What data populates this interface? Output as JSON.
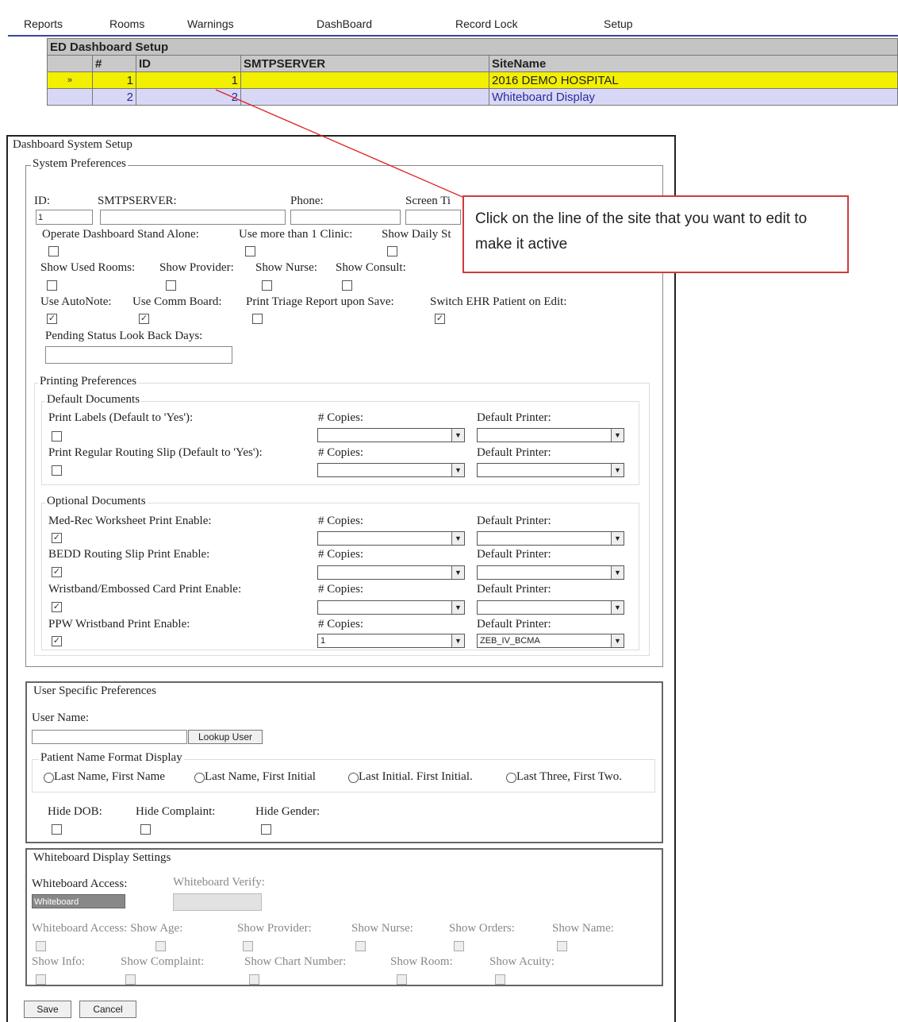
{
  "menu": [
    "Reports",
    "Rooms",
    "Warnings",
    "DashBoard",
    "Record Lock",
    "Setup"
  ],
  "grid": {
    "title": "ED Dashboard Setup",
    "headers": [
      "#",
      "ID",
      "SMTPSERVER",
      "SiteName"
    ],
    "rows": [
      {
        "marker": "»",
        "num": "1",
        "id": "1",
        "smtp": "",
        "site": "2016 DEMO HOSPITAL"
      },
      {
        "marker": "",
        "num": "2",
        "id": "2",
        "smtp": "",
        "site": "Whiteboard Display"
      }
    ]
  },
  "callout": {
    "text": "Click on the line of the site that you want to edit to make it active",
    "border_color": "#d23a3a"
  },
  "panel": {
    "title": "Dashboard System Setup",
    "system_preferences": {
      "legend": "System Preferences",
      "id_label": "ID:",
      "id_value": "1",
      "smtp_label": "SMTPSERVER:",
      "phone_label": "Phone:",
      "screen_label": "Screen Ti",
      "row1": [
        {
          "label": "Operate Dashboard Stand Alone:",
          "checked": false
        },
        {
          "label": "Use more than 1 Clinic:",
          "checked": false
        },
        {
          "label": "Show Daily St",
          "checked": false
        }
      ],
      "row2": [
        {
          "label": "Show Used Rooms:",
          "checked": false
        },
        {
          "label": "Show Provider:",
          "checked": false
        },
        {
          "label": "Show Nurse:",
          "checked": false
        },
        {
          "label": "Show Consult:",
          "checked": false
        }
      ],
      "row3": [
        {
          "label": "Use AutoNote:",
          "checked": true
        },
        {
          "label": "Use Comm Board:",
          "checked": true
        },
        {
          "label": "Print Triage Report upon Save:",
          "checked": false
        },
        {
          "label": "Switch EHR Patient on Edit:",
          "checked": true
        }
      ],
      "pending_label": "Pending Status Look Back Days:"
    },
    "printing": {
      "legend": "Printing Preferences",
      "default_docs_legend": "Default Documents",
      "copies_label": "# Copies:",
      "printer_label": "Default Printer:",
      "default_docs": [
        {
          "label": "Print Labels (Default to 'Yes'):",
          "checked": false,
          "copies": "",
          "printer": ""
        },
        {
          "label": "Print Regular Routing Slip (Default to 'Yes'):",
          "checked": false,
          "copies": "",
          "printer": ""
        }
      ],
      "optional_docs_legend": "Optional Documents",
      "optional_docs": [
        {
          "label": "Med-Rec Worksheet Print Enable:",
          "checked": true,
          "copies": "",
          "printer": ""
        },
        {
          "label": "BEDD Routing Slip Print Enable:",
          "checked": true,
          "copies": "",
          "printer": ""
        },
        {
          "label": "Wristband/Embossed Card Print Enable:",
          "checked": true,
          "copies": "",
          "printer": ""
        },
        {
          "label": "PPW Wristband Print Enable:",
          "checked": true,
          "copies": "1",
          "printer": "ZEB_IV_BCMA"
        }
      ]
    },
    "user_prefs": {
      "legend": "User Specific Preferences",
      "user_name_label": "User Name:",
      "lookup_button": "Lookup User",
      "name_format_legend": "Patient Name Format Display",
      "name_formats": [
        "Last Name, First Name",
        "Last Name, First Initial",
        "Last Initial. First Initial.",
        "Last Three, First Two."
      ],
      "hide": [
        {
          "label": "Hide DOB:",
          "checked": false
        },
        {
          "label": "Hide Complaint:",
          "checked": false
        },
        {
          "label": "Hide Gender:",
          "checked": false
        }
      ]
    },
    "whiteboard": {
      "legend": "Whiteboard Display Settings",
      "access_label": "Whiteboard Access:",
      "access_value": "Whiteboard",
      "verify_label": "Whiteboard Verify:",
      "row1": [
        "Whiteboard Access: Show Age:",
        "Show Provider:",
        "Show Nurse:",
        "Show Orders:",
        "Show Name:"
      ],
      "row2": [
        "Show Info:",
        "Show Complaint:",
        "Show Chart Number:",
        "Show Room:",
        "Show Acuity:"
      ]
    },
    "save_button": "Save",
    "cancel_button": "Cancel"
  }
}
